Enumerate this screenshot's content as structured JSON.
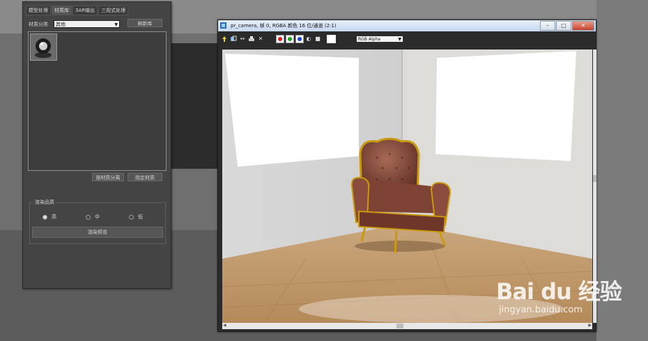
{
  "left_panel": {
    "tabs": [
      {
        "label": "模型处理"
      },
      {
        "label": "材质库"
      },
      {
        "label": "3AR输出"
      },
      {
        "label": "三视式处理"
      }
    ],
    "category_label": "材质分类",
    "category_value": "其他",
    "refresh_button": "刷新库",
    "assign_button": "按材质分离",
    "pick_button": "指定材质",
    "quality_group_title": "渲染品质",
    "quality_options": [
      {
        "label": "高",
        "selected": true
      },
      {
        "label": "中",
        "selected": false
      },
      {
        "label": "低",
        "selected": false
      }
    ],
    "render_button": "渲染预览"
  },
  "render_window": {
    "title": "pr_camera, 帧 0, RGBA 颜色 16 位/通道 (2:1)",
    "channel_select": "RGB Alpha",
    "close_glyph": "✕",
    "min_glyph": "–",
    "max_glyph": "□"
  },
  "watermark": {
    "brand": "Bai du 经验",
    "url": "jingyan.baidu.com"
  },
  "colors": {
    "red_channel": "#e21b1b",
    "green_channel": "#18a418",
    "blue_channel": "#1b3de2",
    "panel_bg": "#444444"
  }
}
